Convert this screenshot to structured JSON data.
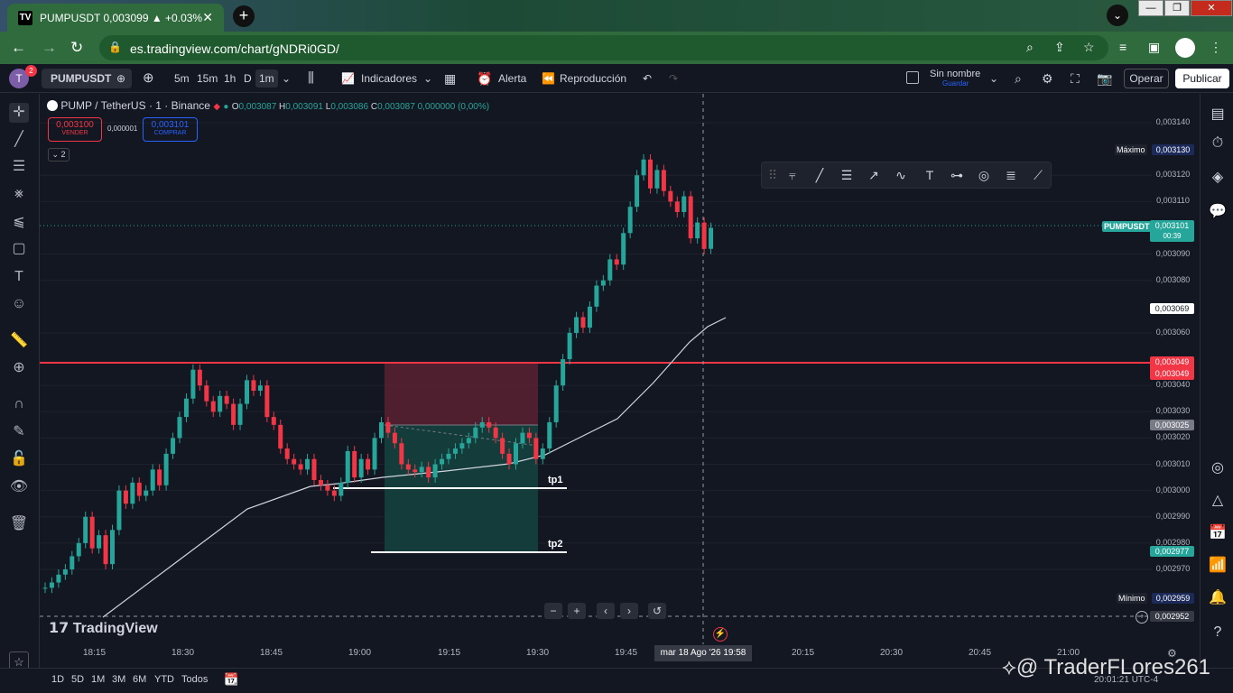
{
  "browser": {
    "tab_title": "PUMPUSDT 0,003099 ▲ +0.03%",
    "favicon": "TV",
    "url": "es.tradingview.com/chart/gNDRi0GD/"
  },
  "toolbar": {
    "avatar_letter": "T",
    "avatar_badge": "2",
    "symbol": "PUMPUSDT",
    "timeframes": [
      "5m",
      "15m",
      "1h",
      "D",
      "1m"
    ],
    "indicators_label": "Indicadores",
    "alert_label": "Alerta",
    "replay_label": "Reproducción",
    "layout_name": "Sin nombre",
    "save_label": "Guardar",
    "trade_label": "Operar",
    "publish_label": "Publicar"
  },
  "legend": {
    "title": "PUMP / TetherUS · 1 · Binance",
    "o_label": "O",
    "o": "0,003087",
    "h_label": "H",
    "h": "0,003091",
    "l_label": "L",
    "l": "0,003086",
    "c_label": "C",
    "c": "0,003087",
    "change": "0,000000 (0,00%)",
    "sell_price": "0,003100",
    "sell_label": "VENDER",
    "spread": "0,000001",
    "buy_price": "0,003101",
    "buy_label": "COMPRAR",
    "collapsed_count": "2"
  },
  "price_axis": {
    "labels": [
      {
        "v": 0.00314,
        "t": "0,003140"
      },
      {
        "v": 0.00312,
        "t": "0,003120"
      },
      {
        "v": 0.00311,
        "t": "0,003110"
      },
      {
        "v": 0.00309,
        "t": "0,003090"
      },
      {
        "v": 0.00308,
        "t": "0,003080"
      },
      {
        "v": 0.00306,
        "t": "0,003060"
      },
      {
        "v": 0.00304,
        "t": "0,003040"
      },
      {
        "v": 0.00303,
        "t": "0,003030"
      },
      {
        "v": 0.00302,
        "t": "0,003020"
      },
      {
        "v": 0.00301,
        "t": "0,003010"
      },
      {
        "v": 0.003,
        "t": "0,003000"
      },
      {
        "v": 0.00299,
        "t": "0,002990"
      },
      {
        "v": 0.00298,
        "t": "0,002980"
      },
      {
        "v": 0.00297,
        "t": "0,002970"
      }
    ],
    "max_label": "Máximo",
    "max_value": "0,003130",
    "min_label": "Mínimo",
    "min_value": "0,002959",
    "symbol_tag": "PUMPUSDT",
    "last_price": "0,003101",
    "countdown": "00:39",
    "ma_value": "0,003069",
    "line_value_1": "0,003049",
    "line_value_2": "0,003049",
    "entry_value": "0,003025",
    "target_value": "0,002977",
    "cross_value": "0,002952"
  },
  "time_axis": {
    "labels": [
      "18:15",
      "18:30",
      "18:45",
      "19:00",
      "19:15",
      "19:30",
      "19:45",
      "20:15",
      "20:30",
      "20:45",
      "21:00"
    ],
    "crosshair": "mar 18 Ago '26   19:58"
  },
  "chart": {
    "tp1_label": "tp1",
    "tp2_label": "tp2",
    "logo_text": "TradingView",
    "up_color": "#26a69a",
    "down_color": "#f23645"
  },
  "bottom": {
    "ranges": [
      "1D",
      "5D",
      "1M",
      "3M",
      "6M",
      "YTD",
      "Todos"
    ],
    "watermark": "@ TraderFLores261",
    "clock": "20:01:21 UTC-4"
  }
}
